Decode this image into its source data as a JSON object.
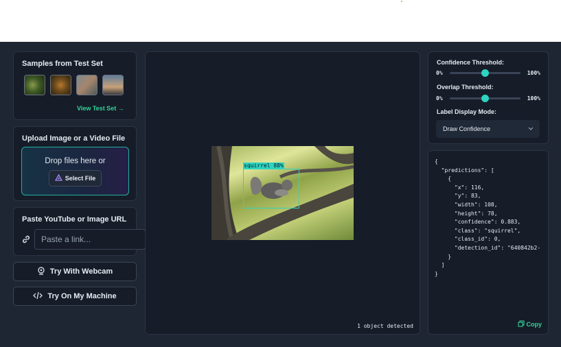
{
  "samples": {
    "title": "Samples from Test Set",
    "view_link": "View Test Set →",
    "thumbnails": [
      "sample-1",
      "sample-2",
      "sample-3",
      "sample-4"
    ]
  },
  "upload": {
    "title": "Upload Image or a Video File",
    "drop_text": "Drop files here or",
    "select_button": "Select File"
  },
  "url": {
    "title": "Paste YouTube or Image URL",
    "placeholder": "Paste a link..."
  },
  "buttons": {
    "webcam": "Try With Webcam",
    "machine": "Try On My Machine"
  },
  "preview": {
    "detection_label": "squirrel 88%",
    "status": "1 object detected"
  },
  "settings": {
    "confidence_label": "Confidence Threshold:",
    "overlap_label": "Overlap Threshold:",
    "min_label": "0%",
    "max_label": "100%",
    "confidence_value": 0.5,
    "overlap_value": 0.5,
    "display_mode_label": "Label Display Mode:",
    "display_mode_value": "Draw Confidence"
  },
  "output": {
    "json_text": "{\n  \"predictions\": [\n    {\n      \"x\": 116,\n      \"y\": 83,\n      \"width\": 108,\n      \"height\": 78,\n      \"confidence\": 0.883,\n      \"class\": \"squirrel\",\n      \"class_id\": 0,\n      \"detection_id\": \"640842b2-\n    }\n  ]\n}",
    "copy_label": "Copy"
  },
  "colors": {
    "accent": "#2dd4bf",
    "link": "#34d399",
    "background": "#1f2633",
    "panel": "#161c28"
  }
}
